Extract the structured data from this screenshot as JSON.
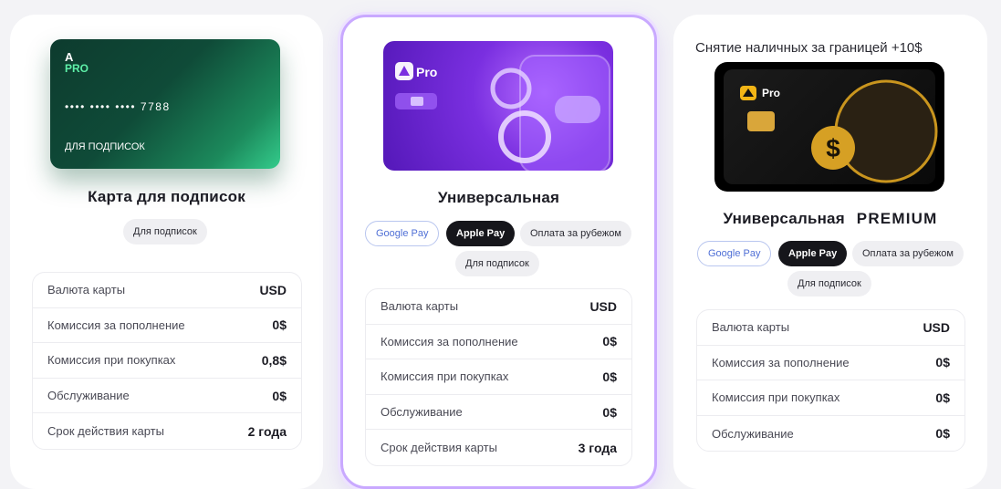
{
  "cards": [
    {
      "card_image": {
        "logo_a": "A",
        "logo_pro": "PRO",
        "number": "•••• •••• •••• 7788",
        "label": "ДЛЯ ПОДПИСОК"
      },
      "title": "Карта для подписок",
      "tags": [
        "Для подписок"
      ],
      "rows": [
        {
          "label": "Валюта карты",
          "value": "USD"
        },
        {
          "label": "Комиссия за пополнение",
          "value": "0$"
        },
        {
          "label": "Комиссия при покупках",
          "value": "0,8$"
        },
        {
          "label": "Обслуживание",
          "value": "0$"
        },
        {
          "label": "Срок действия карты",
          "value": "2 года"
        }
      ]
    },
    {
      "card_image": {
        "logo_pro": "Pro"
      },
      "title": "Универсальная",
      "tags": [
        "Google Pay",
        "Apple Pay",
        "Оплата за рубежом",
        "Для подписок"
      ],
      "rows": [
        {
          "label": "Валюта карты",
          "value": "USD"
        },
        {
          "label": "Комиссия за пополнение",
          "value": "0$"
        },
        {
          "label": "Комиссия при покупках",
          "value": "0$"
        },
        {
          "label": "Обслуживание",
          "value": "0$"
        },
        {
          "label": "Срок действия карты",
          "value": "3 года"
        }
      ]
    },
    {
      "header_note": "Снятие наличных за границей +10$",
      "card_image": {
        "logo_pro": "Pro"
      },
      "title": "Универсальная",
      "title_suffix": "PREMIUM",
      "tags": [
        "Google Pay",
        "Apple Pay",
        "Оплата за рубежом",
        "Для подписок"
      ],
      "rows": [
        {
          "label": "Валюта карты",
          "value": "USD"
        },
        {
          "label": "Комиссия за пополнение",
          "value": "0$"
        },
        {
          "label": "Комиссия при покупках",
          "value": "0$"
        },
        {
          "label": "Обслуживание",
          "value": "0$"
        }
      ]
    }
  ],
  "colors": {
    "accent_purple": "#c9a9ff",
    "green_card": "#1c8a5c",
    "google_pay_blue": "#4f6fd6"
  }
}
